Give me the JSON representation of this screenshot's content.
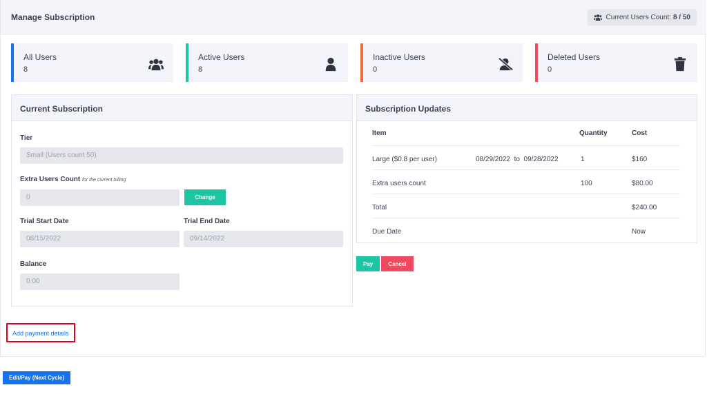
{
  "header": {
    "title": "Manage Subscription",
    "users_count_label": "Current Users Count:",
    "users_count_value": "8 / 50"
  },
  "stats": [
    {
      "label": "All Users",
      "value": "8",
      "color": "#1573ee",
      "icon": "users-group-icon"
    },
    {
      "label": "Active Users",
      "value": "8",
      "color": "#1ec5a2",
      "icon": "user-icon"
    },
    {
      "label": "Inactive Users",
      "value": "0",
      "color": "#f26b3a",
      "icon": "user-slash-icon"
    },
    {
      "label": "Deleted Users",
      "value": "0",
      "color": "#ef4a5f",
      "icon": "trash-icon"
    }
  ],
  "current": {
    "title": "Current Subscription",
    "tier_label": "Tier",
    "tier_value": "Small (Users count 50)",
    "extra_label": "Extra Users Count",
    "extra_hint": "for the current billing",
    "extra_value": "0",
    "change_label": "Change",
    "trial_start_label": "Trial Start Date",
    "trial_start_value": "08/15/2022",
    "trial_end_label": "Trial End Date",
    "trial_end_value": "09/14/2022",
    "balance_label": "Balance",
    "balance_value": "0.00"
  },
  "updates": {
    "title": "Subscription Updates",
    "columns": {
      "item": "Item",
      "quantity": "Quantity",
      "cost": "Cost"
    },
    "rows": [
      {
        "item": "Large ($0.8 per user)",
        "period": "08/29/2022  to  09/28/2022",
        "quantity": "1",
        "cost": "$160"
      },
      {
        "item": "Extra users count",
        "period": "",
        "quantity": "100",
        "cost": "$80.00"
      },
      {
        "item": "Total",
        "period": "",
        "quantity": "",
        "cost": "$240.00"
      },
      {
        "item": "Due Date",
        "period": "",
        "quantity": "",
        "cost": "Now"
      }
    ],
    "pay_label": "Pay",
    "cancel_label": "Cancel"
  },
  "links": {
    "add_payment": "Add payment details"
  },
  "footer": {
    "edit_pay_label": "Edit/Pay (Next Cycle)"
  }
}
